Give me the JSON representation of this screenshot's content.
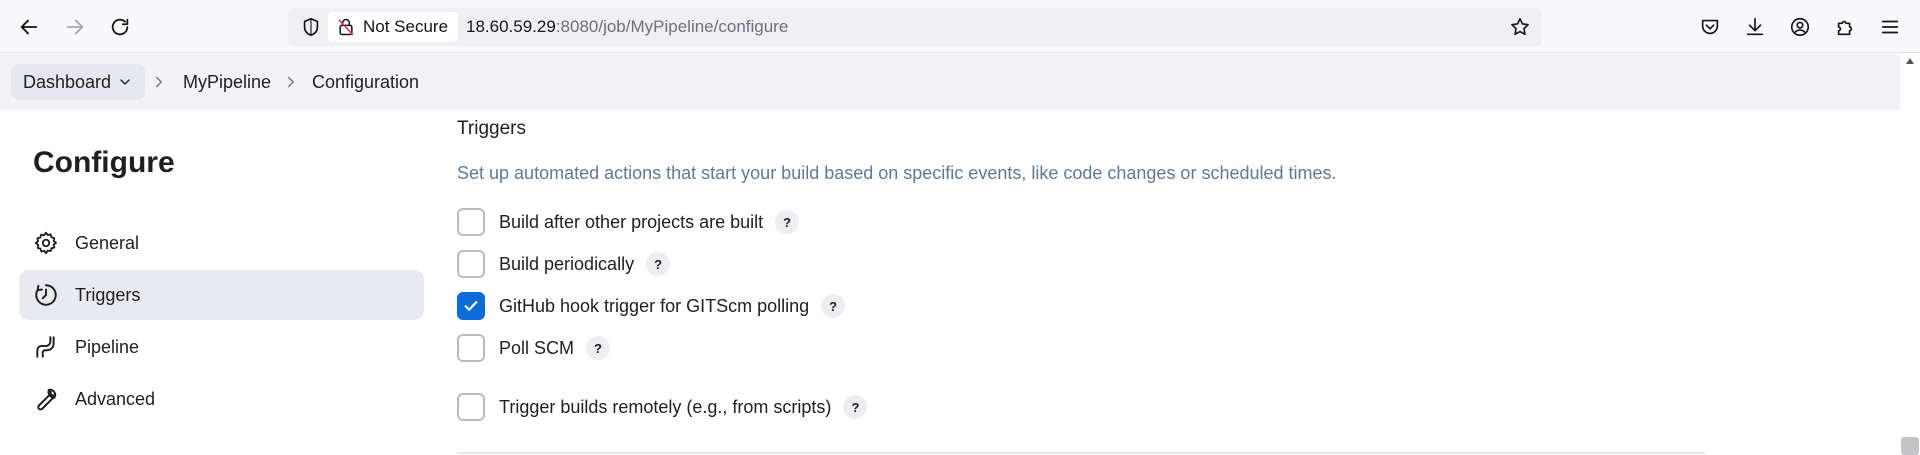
{
  "browser": {
    "not_secure_label": "Not Secure",
    "url_host": "18.60.59.29",
    "url_rest": ":8080/job/MyPipeline/configure"
  },
  "breadcrumb": {
    "dashboard": "Dashboard",
    "pipeline": "MyPipeline",
    "configuration": "Configuration"
  },
  "sidebar": {
    "title": "Configure",
    "items": [
      {
        "label": "General",
        "icon": "gear-icon"
      },
      {
        "label": "Triggers",
        "icon": "timer-icon",
        "active": true
      },
      {
        "label": "Pipeline",
        "icon": "pipeline-icon"
      },
      {
        "label": "Advanced",
        "icon": "wrench-icon"
      }
    ]
  },
  "triggers": {
    "title": "Triggers",
    "description": "Set up automated actions that start your build based on specific events, like code changes or scheduled times.",
    "help_label": "?",
    "options": [
      {
        "label": "Build after other projects are built",
        "checked": false
      },
      {
        "label": "Build periodically",
        "checked": false
      },
      {
        "label": "GitHub hook trigger for GITScm polling",
        "checked": true
      },
      {
        "label": "Poll SCM",
        "checked": false
      },
      {
        "label": "Trigger builds remotely (e.g., from scripts)",
        "checked": false
      }
    ]
  },
  "colors": {
    "accent": "#0b6bd8",
    "description_text": "#5f7a95",
    "active_bg": "#e9e9f0"
  }
}
